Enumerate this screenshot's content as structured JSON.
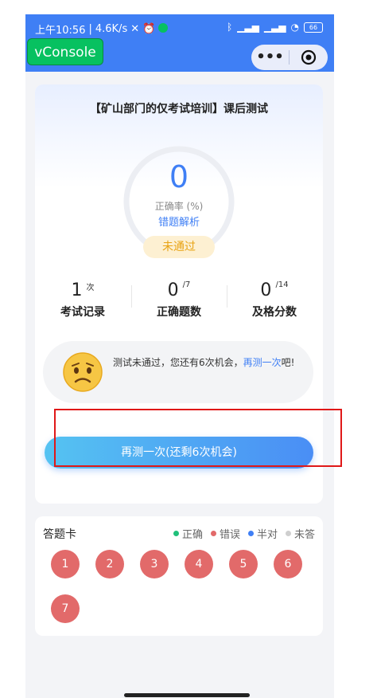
{
  "status_bar": {
    "time": "上午10:56",
    "separator": "|",
    "speed": "4.6K/s",
    "battery": "66"
  },
  "vconsole": {
    "label": "vConsole"
  },
  "capsule": {
    "more_icon": "more-dots-icon",
    "close_icon": "target-icon"
  },
  "result": {
    "title": "【矿山部门的仅考试培训】课后测试",
    "score": "0",
    "rate_label": "正确率 (%)",
    "wrong_link": "错题解析",
    "status": "未通过"
  },
  "stats": [
    {
      "value": "1",
      "unit": "次",
      "label": "考试记录"
    },
    {
      "value": "0",
      "unit": "/7",
      "label": "正确题数"
    },
    {
      "value": "0",
      "unit": "/14",
      "label": "及格分数"
    }
  ],
  "tip": {
    "text": "测试未通过，您还有6次机会，",
    "link": "再测一次",
    "suffix": "吧!"
  },
  "retry_button": "再测一次(还剩6次机会)",
  "answer_card": {
    "title": "答题卡",
    "legend": [
      {
        "label": "正确",
        "color": "#20c07a"
      },
      {
        "label": "错误",
        "color": "#e26a6a"
      },
      {
        "label": "半对",
        "color": "#3f7ff5"
      },
      {
        "label": "未答",
        "color": "#cfcfcf"
      }
    ],
    "questions": [
      "1",
      "2",
      "3",
      "4",
      "5",
      "6",
      "7"
    ]
  },
  "colors": {
    "primary": "#3f7ff5",
    "wrong": "#e26a6a",
    "highlight_box": "#e01818"
  }
}
